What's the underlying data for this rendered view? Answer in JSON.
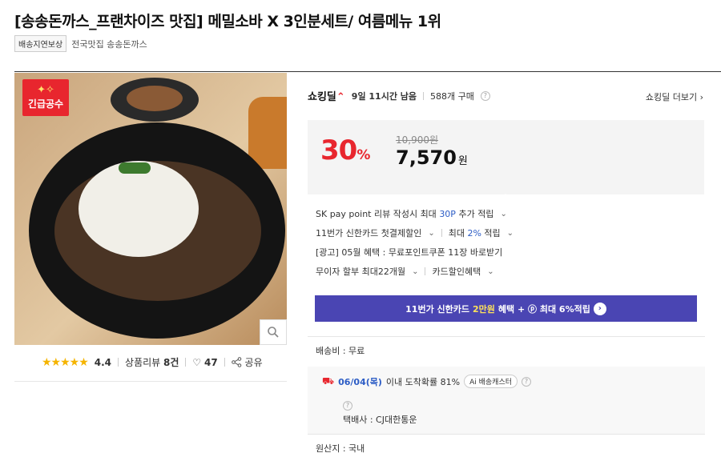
{
  "product": {
    "title": "[송송돈까스_프랜차이즈 맛집] 메밀소바 X 3인분세트/ 여름메뉴 1위",
    "badge": "배송지연보상",
    "seller": "전국맛집 송송돈까스"
  },
  "image": {
    "urgent_badge": "긴급공수",
    "urgent_icon": "sparkle-icon",
    "zoom_icon": "magnifier-icon"
  },
  "rating": {
    "stars": "★★★★★",
    "score": "4.4",
    "reviews_label": "상품리뷰",
    "reviews_count": "8건",
    "likes": "47",
    "share_label": "공유"
  },
  "deal": {
    "logo_text": "쇼킹딜",
    "time_left": "9일 11시간 남음",
    "purchases": "588개 구매",
    "more_label": "쇼킹딜 더보기"
  },
  "price": {
    "discount": "30",
    "discount_unit": "%",
    "original": "10,900원",
    "final": "7,570",
    "currency": "원"
  },
  "benefits": {
    "sk_pre": "SK pay point 리뷰 작성시 최대",
    "sk_points": "30P",
    "sk_post": "추가 적립",
    "card_label": "11번가 신한카드 첫결제할인",
    "card_max_pre": "최대",
    "card_pct": "2%",
    "card_max_post": "적립",
    "ad": "[광고] 05월 혜택 : 무료포인트쿠폰 11장 바로받기",
    "installment": "무이자 할부 최대22개월",
    "card_discount": "카드할인혜택"
  },
  "banner": {
    "pre": "11번가 신한카드",
    "highlight": "2만원",
    "post": "혜택 + ⓟ 최대 6%적립"
  },
  "shipping": {
    "fee": "배송비 : 무료",
    "date": "06/04(목)",
    "arrival_text": "이내 도착확률 81%",
    "ai_label": "Ai 배송캐스터",
    "courier": "택배사 : CJ대한통운",
    "origin": "원산지 : 국내"
  },
  "colors": {
    "accent_red": "#e8262e",
    "banner_purple": "#4a45b3",
    "link_blue": "#2c5cc5"
  }
}
